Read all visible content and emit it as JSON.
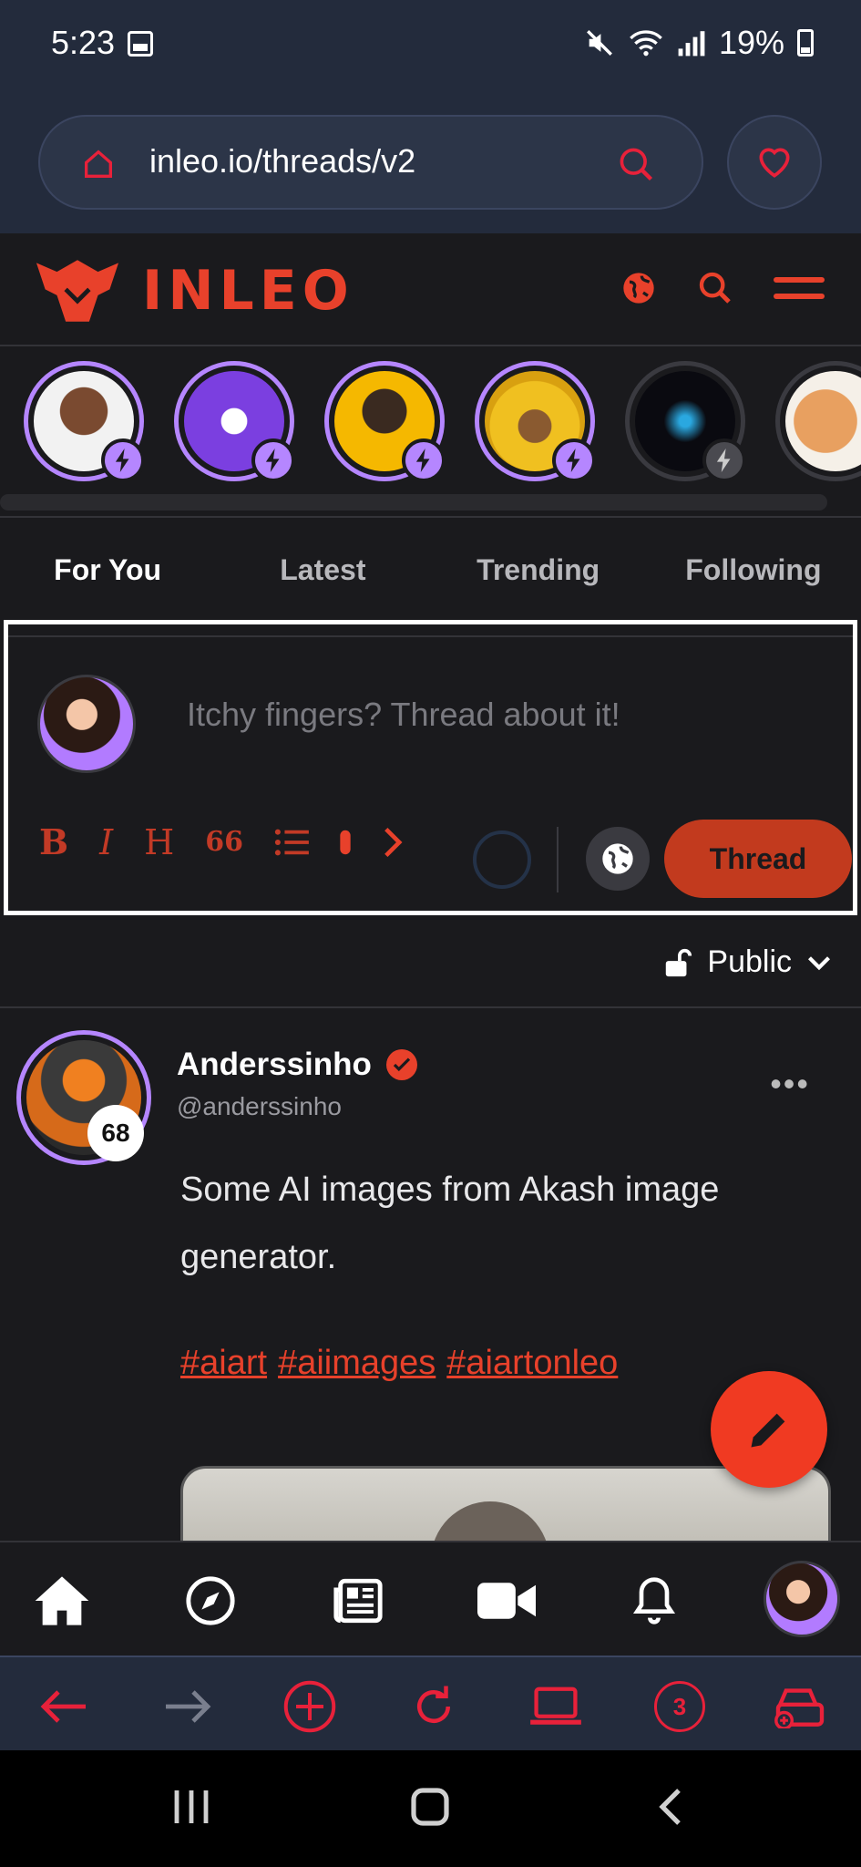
{
  "status_bar": {
    "time": "5:23",
    "battery": "19%"
  },
  "browser": {
    "url": "inleo.io/threads/v2"
  },
  "app": {
    "logo_text": "INLEO"
  },
  "tabs": [
    {
      "label": "For You",
      "active": true
    },
    {
      "label": "Latest",
      "active": false
    },
    {
      "label": "Trending",
      "active": false
    },
    {
      "label": "Following",
      "active": false
    }
  ],
  "composer": {
    "placeholder": "Itchy fingers? Thread about it!",
    "format_buttons": [
      "B",
      "I",
      "H",
      "66"
    ],
    "submit_label": "Thread"
  },
  "visibility": {
    "label": "Public"
  },
  "post": {
    "author_name": "Anderssinho",
    "handle": "@anderssinho",
    "level": "68",
    "text": "Some AI images from Akash image generator.",
    "tags": [
      "#aiart",
      "#aiimages",
      "#aiartonleo"
    ]
  },
  "browser_toolbar": {
    "tab_count": "3"
  },
  "colors": {
    "accent": "#e8412b",
    "story_ring": "#b586ff",
    "browser_red": "#e8213a",
    "bg": "#1a1a1d"
  }
}
